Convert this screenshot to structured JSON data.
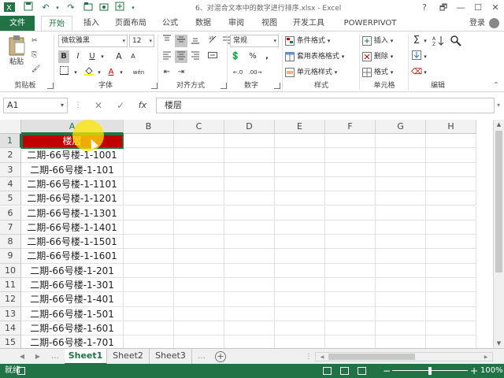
{
  "window": {
    "title": "6、对混合文本中的数字进行排序.xlsx - Excel",
    "controls": {
      "help": "?",
      "restore": "🗗",
      "minimize": "—",
      "maximize": "☐",
      "close": "✕"
    }
  },
  "ribbon_tabs": {
    "file": "文件",
    "tabs": [
      "开始",
      "插入",
      "页面布局",
      "公式",
      "数据",
      "审阅",
      "视图",
      "开发工具",
      "POWERPIVOT"
    ],
    "active_tab": "开始",
    "login": "登录"
  },
  "ribbon": {
    "clipboard": {
      "paste": "粘贴",
      "label": "剪贴板"
    },
    "font": {
      "family": "微软雅黑",
      "size": "12",
      "bold": "B",
      "italic": "I",
      "underline": "U",
      "grow": "A",
      "shrink": "A",
      "font_color": "A",
      "wen": "wén",
      "label": "字体"
    },
    "alignment": {
      "label": "对齐方式"
    },
    "number": {
      "format": "常规",
      "percent": "%",
      "comma": ",",
      "label": "数字"
    },
    "styles": {
      "conditional": "条件格式",
      "table": "套用表格格式",
      "cell_styles": "单元格样式",
      "label": "样式"
    },
    "cells": {
      "insert": "插入",
      "delete": "删除",
      "format": "格式",
      "label": "单元格"
    },
    "editing": {
      "sum": "Σ",
      "label": "编辑"
    }
  },
  "formula_bar": {
    "name_box": "A1",
    "cancel": "✕",
    "enter": "✓",
    "fx": "fx",
    "value": "楼层"
  },
  "grid": {
    "columns": [
      "A",
      "B",
      "C",
      "D",
      "E",
      "F",
      "G",
      "H"
    ],
    "selected_column": "A",
    "rows": [
      "1",
      "2",
      "3",
      "4",
      "5",
      "6",
      "7",
      "8",
      "9",
      "10",
      "11",
      "12",
      "13",
      "14",
      "15"
    ],
    "selected_row": "1",
    "column_a": [
      "楼层",
      "二期-66号楼-1-1001",
      "二期-66号楼-1-101",
      "二期-66号楼-1-1101",
      "二期-66号楼-1-1201",
      "二期-66号楼-1-1301",
      "二期-66号楼-1-1401",
      "二期-66号楼-1-1501",
      "二期-66号楼-1-1601",
      "二期-66号楼-1-201",
      "二期-66号楼-1-301",
      "二期-66号楼-1-401",
      "二期-66号楼-1-501",
      "二期-66号楼-1-601",
      "二期-66号楼-1-701"
    ],
    "header_fill": "#c00000"
  },
  "sheets": {
    "tabs": [
      "Sheet1",
      "Sheet2",
      "Sheet3"
    ],
    "active": "Sheet1",
    "add": "+"
  },
  "status": {
    "text": "就绪",
    "zoom_minus": "−",
    "zoom_plus": "+",
    "zoom_level": "100%"
  },
  "colors": {
    "accent": "#217346",
    "header_red": "#c00000",
    "cursor_halo": "#ffe600"
  }
}
